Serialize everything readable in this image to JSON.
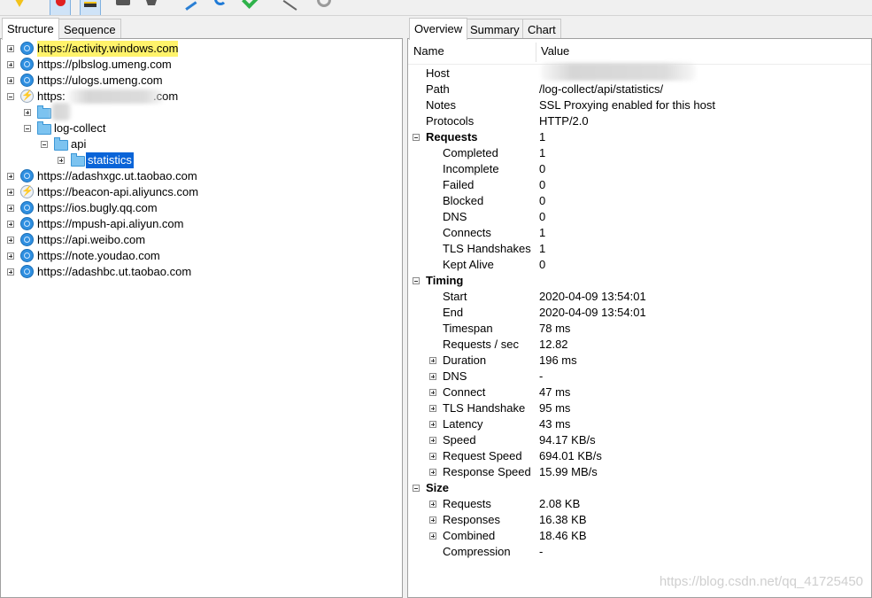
{
  "toolbar": {
    "icons": [
      "pen-tip-icon",
      "record-icon",
      "throttle-icon",
      "turtle-icon",
      "stop-icon",
      "pencil-icon",
      "refresh-icon",
      "check-icon",
      "tools-icon",
      "settings-icon"
    ]
  },
  "left_tabs": [
    "Structure",
    "Sequence"
  ],
  "right_tabs": [
    "Overview",
    "Summary",
    "Chart"
  ],
  "tree": {
    "hosts": [
      {
        "label": "https://activity.windows.com",
        "icon": "globe-icon"
      },
      {
        "label": "https://plbslog.umeng.com",
        "icon": "globe-icon"
      },
      {
        "label": "https://ulogs.umeng.com",
        "icon": "globe-icon"
      },
      {
        "label_start": "https:",
        "label_end": ".com",
        "icon": "lightning-icon"
      },
      {
        "label": "https://adashxgc.ut.taobao.com",
        "icon": "globe-icon"
      },
      {
        "label": "https://beacon-api.aliyuncs.com",
        "icon": "lightning-icon"
      },
      {
        "label": "https://ios.bugly.qq.com",
        "icon": "globe-icon"
      },
      {
        "label": "https://mpush-api.aliyun.com",
        "icon": "globe-icon"
      },
      {
        "label": "https://api.weibo.com",
        "icon": "globe-icon"
      },
      {
        "label": "https://note.youdao.com",
        "icon": "globe-icon"
      },
      {
        "label": "https://adashbc.ut.taobao.com",
        "icon": "globe-icon"
      }
    ],
    "folders": [
      "log-collect",
      "api",
      "statistics"
    ]
  },
  "overview": {
    "col_name": "Name",
    "col_value": "Value",
    "host": {
      "name": "Host",
      "value": ""
    },
    "path": {
      "name": "Path",
      "value": "/log-collect/api/statistics/"
    },
    "notes": {
      "name": "Notes",
      "value": "SSL Proxying enabled for this host"
    },
    "protocols": {
      "name": "Protocols",
      "value": "HTTP/2.0"
    },
    "requests": {
      "name": "Requests",
      "value": "1",
      "items": [
        {
          "name": "Completed",
          "value": "1"
        },
        {
          "name": "Incomplete",
          "value": "0"
        },
        {
          "name": "Failed",
          "value": "0"
        },
        {
          "name": "Blocked",
          "value": "0"
        },
        {
          "name": "DNS",
          "value": "0"
        },
        {
          "name": "Connects",
          "value": "1"
        },
        {
          "name": "TLS Handshakes",
          "value": "1"
        },
        {
          "name": "Kept Alive",
          "value": "0"
        }
      ]
    },
    "timing": {
      "name": "Timing",
      "items": [
        {
          "name": "Start",
          "value": "2020-04-09 13:54:01"
        },
        {
          "name": "End",
          "value": "2020-04-09 13:54:01"
        },
        {
          "name": "Timespan",
          "value": "78 ms"
        },
        {
          "name": "Requests / sec",
          "value": "12.82"
        },
        {
          "name": "Duration",
          "value": "196 ms"
        },
        {
          "name": "DNS",
          "value": "-"
        },
        {
          "name": "Connect",
          "value": "47 ms"
        },
        {
          "name": "TLS Handshake",
          "value": "95 ms"
        },
        {
          "name": "Latency",
          "value": "43 ms"
        },
        {
          "name": "Speed",
          "value": "94.17 KB/s"
        },
        {
          "name": "Request Speed",
          "value": "694.01 KB/s"
        },
        {
          "name": "Response Speed",
          "value": "15.99 MB/s"
        }
      ]
    },
    "size": {
      "name": "Size",
      "items": [
        {
          "name": "Requests",
          "value": "2.08 KB"
        },
        {
          "name": "Responses",
          "value": "16.38 KB"
        },
        {
          "name": "Combined",
          "value": "18.46 KB"
        },
        {
          "name": "Compression",
          "value": "-"
        }
      ]
    }
  },
  "watermark": "https://blog.csdn.net/qq_41725450"
}
